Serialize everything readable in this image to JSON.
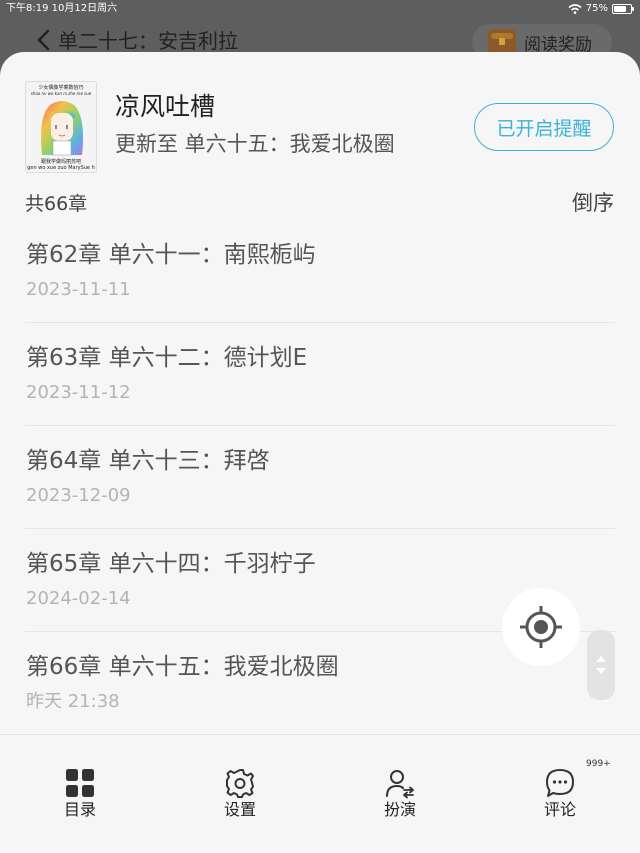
{
  "status_bar": {
    "time_date": "下午8:19  10月12日周六",
    "battery": "75%",
    "battery_level": 0.75
  },
  "reader_header": {
    "title": "单二十七：安吉利拉",
    "reward_label": "阅读奖励"
  },
  "book": {
    "cover": {
      "top_text": "少女偶像学乘数恰巧",
      "sub_text": "shao nv wo kan ni zhe me sue",
      "bottom_text": "跟我学做玛丽苏吧",
      "bottom_pinyin": "gen wo xue zuo MarySue h"
    },
    "title": "凉风吐槽",
    "update": "更新至 单六十五：我爱北极圈",
    "remind_label": "已开启提醒"
  },
  "chapter_count": "共66章",
  "sort_label": "倒序",
  "chapters": [
    {
      "title": "第62章 单六十一：南熙栀屿",
      "date": "2023-11-11"
    },
    {
      "title": "第63章 单六十二：德计划E",
      "date": "2023-11-12"
    },
    {
      "title": "第64章 单六十三：拜啓",
      "date": "2023-12-09"
    },
    {
      "title": "第65章 单六十四：千羽柠子",
      "date": "2024-02-14"
    },
    {
      "title": "第66章 单六十五：我爱北极圈",
      "date": "昨天 21:38"
    }
  ],
  "bottom_nav": {
    "items": [
      {
        "label": "目录",
        "icon": "catalog-grid-icon"
      },
      {
        "label": "设置",
        "icon": "settings-gear-icon"
      },
      {
        "label": "扮演",
        "icon": "role-play-person-icon"
      },
      {
        "label": "评论",
        "icon": "comment-bubble-icon"
      }
    ],
    "comment_badge": "999+"
  },
  "colors": {
    "accent": "#3bb2d8",
    "sheet_bg": "#f6f6f6",
    "overlay": "#5e5e5e"
  }
}
